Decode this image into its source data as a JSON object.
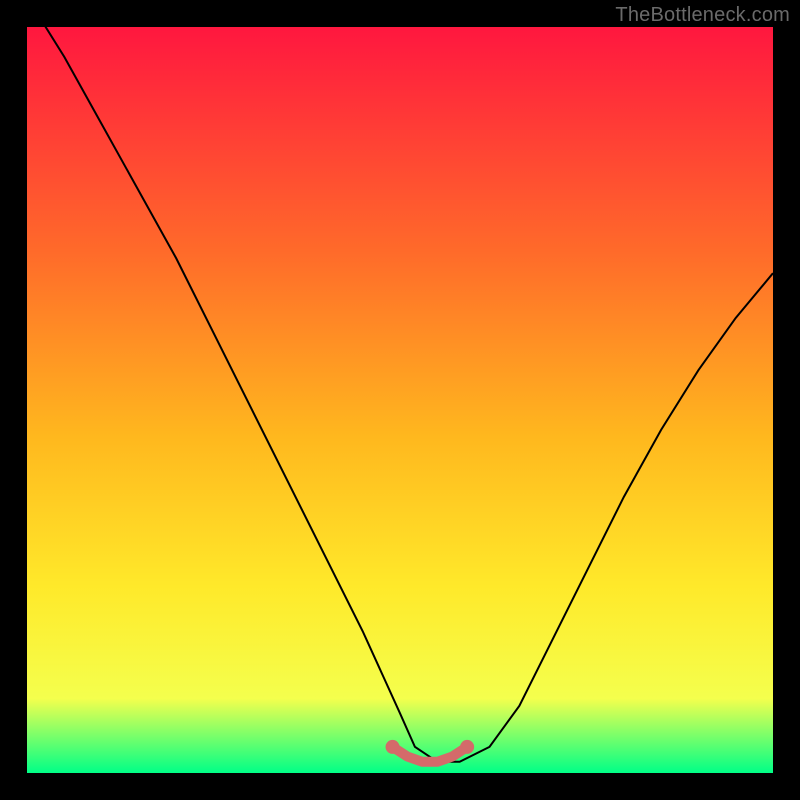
{
  "attribution": "TheBottleneck.com",
  "colors": {
    "background": "#000000",
    "gradient_top": "#ff173f",
    "gradient_mid1": "#ff6a2a",
    "gradient_mid2": "#ffb81e",
    "gradient_mid3": "#ffe92a",
    "gradient_mid4": "#f4ff4d",
    "gradient_bottom": "#00ff87",
    "curve_stroke": "#000000",
    "marker_stroke": "#d46a6a",
    "marker_fill": "#d46a6a"
  },
  "chart_data": {
    "type": "line",
    "title": "",
    "xlabel": "",
    "ylabel": "",
    "xlim": [
      0,
      100
    ],
    "ylim": [
      0,
      100
    ],
    "series": [
      {
        "name": "bottleneck-curve",
        "x": [
          0,
          5,
          10,
          15,
          20,
          25,
          30,
          35,
          40,
          45,
          50,
          52,
          55,
          58,
          62,
          66,
          70,
          75,
          80,
          85,
          90,
          95,
          100
        ],
        "values": [
          104,
          96,
          87,
          78,
          69,
          59,
          49,
          39,
          29,
          19,
          8,
          3.5,
          1.5,
          1.5,
          3.5,
          9,
          17,
          27,
          37,
          46,
          54,
          61,
          67
        ]
      }
    ],
    "markers": {
      "name": "highlight-valley",
      "x": [
        49,
        51,
        53,
        55,
        57,
        59
      ],
      "values": [
        3.5,
        2.2,
        1.5,
        1.5,
        2.2,
        3.5
      ]
    }
  }
}
